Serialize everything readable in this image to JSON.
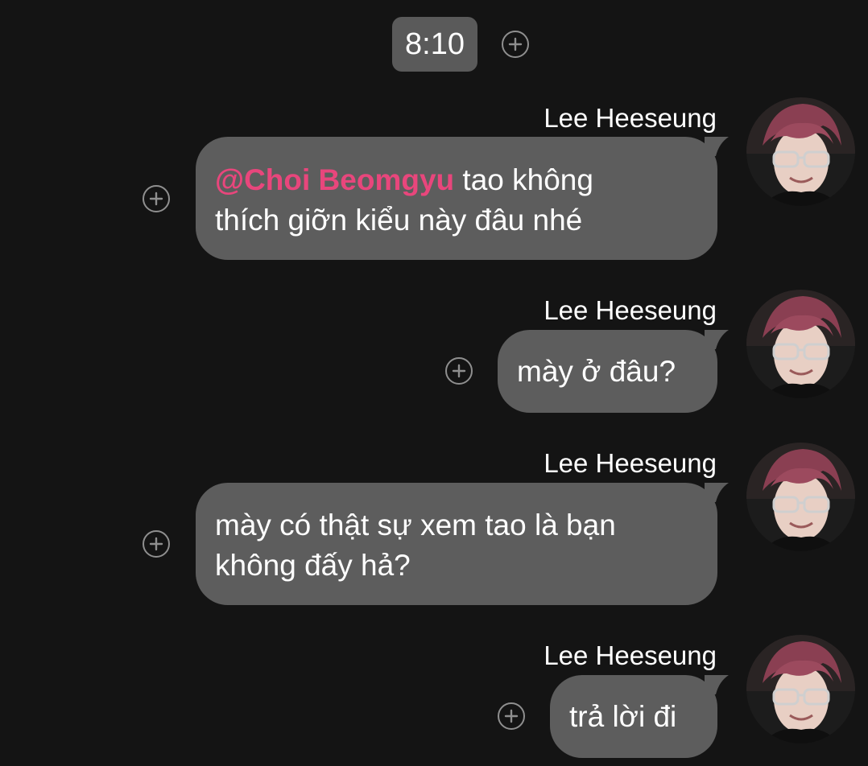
{
  "header": {
    "time": "8:10"
  },
  "messages": [
    {
      "sender": "Lee Heeseung",
      "mention": "@Choi Beomgyu",
      "line1_rest": " tao không",
      "line2": "thích giỡn kiểu này đâu nhé"
    },
    {
      "sender": "Lee Heeseung",
      "text": "mày ở đâu?"
    },
    {
      "sender": "Lee Heeseung",
      "line1": "mày có thật sự xem tao là bạn",
      "line2": "không đấy hả?"
    },
    {
      "sender": "Lee Heeseung",
      "text": "trả lời đi"
    }
  ],
  "colors": {
    "background": "#141414",
    "bubble": "#5d5d5d",
    "time_pill": "#5a5a5a",
    "mention": "#e8467c",
    "add_icon": "#8f8f8f"
  },
  "icons": {
    "add": "plus-circle-icon",
    "avatar": "profile-photo"
  }
}
